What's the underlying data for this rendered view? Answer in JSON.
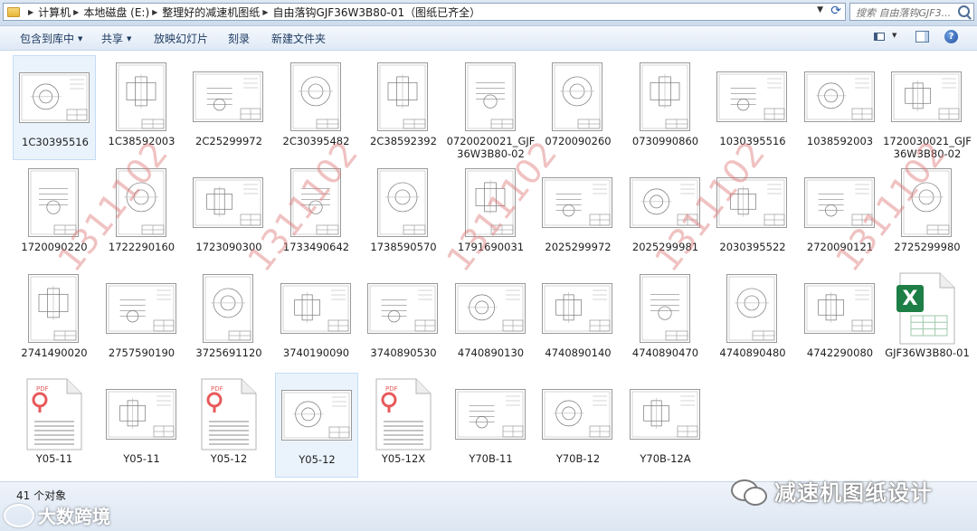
{
  "address": {
    "crumbs": [
      "计算机",
      "本地磁盘 (E:)",
      "整理好的减速机图纸",
      "自由落钩GJF36W3B80-01（图纸已齐全）"
    ]
  },
  "search": {
    "placeholder": "搜索 自由落钩GJF3..."
  },
  "toolbar": {
    "include_in_library": "包含到库中",
    "share": "共享",
    "slideshow": "放映幻灯片",
    "burn": "刻录",
    "new_folder": "新建文件夹"
  },
  "files": [
    {
      "name": "1C30395516",
      "type": "drawing",
      "variant": "land",
      "selected": true
    },
    {
      "name": "1C38592003",
      "type": "drawing",
      "variant": "port"
    },
    {
      "name": "2C25299972",
      "type": "drawing",
      "variant": "land"
    },
    {
      "name": "2C30395482",
      "type": "drawing",
      "variant": "port"
    },
    {
      "name": "2C38592392",
      "type": "drawing",
      "variant": "port"
    },
    {
      "name": "0720020021_GJF36W3B80-02",
      "type": "drawing",
      "variant": "port"
    },
    {
      "name": "0720090260",
      "type": "drawing",
      "variant": "port"
    },
    {
      "name": "0730990860",
      "type": "drawing",
      "variant": "port"
    },
    {
      "name": "1030395516",
      "type": "drawing",
      "variant": "land"
    },
    {
      "name": "1038592003",
      "type": "drawing",
      "variant": "land"
    },
    {
      "name": "1720030021_GJF36W3B80-02",
      "type": "drawing",
      "variant": "land"
    },
    {
      "name": "1720090220",
      "type": "drawing",
      "variant": "port"
    },
    {
      "name": "1722290160",
      "type": "drawing",
      "variant": "port"
    },
    {
      "name": "1723090300",
      "type": "drawing",
      "variant": "land"
    },
    {
      "name": "1733490642",
      "type": "drawing",
      "variant": "port"
    },
    {
      "name": "1738590570",
      "type": "drawing",
      "variant": "port"
    },
    {
      "name": "1791690031",
      "type": "drawing",
      "variant": "port"
    },
    {
      "name": "2025299972",
      "type": "drawing",
      "variant": "land"
    },
    {
      "name": "2025299981",
      "type": "drawing",
      "variant": "land"
    },
    {
      "name": "2030395522",
      "type": "drawing",
      "variant": "land"
    },
    {
      "name": "2720090121",
      "type": "drawing",
      "variant": "land"
    },
    {
      "name": "2725299980",
      "type": "drawing",
      "variant": "port"
    },
    {
      "name": "2741490020",
      "type": "drawing",
      "variant": "port"
    },
    {
      "name": "2757590190",
      "type": "drawing",
      "variant": "land"
    },
    {
      "name": "3725691120",
      "type": "drawing",
      "variant": "port"
    },
    {
      "name": "3740190090",
      "type": "drawing",
      "variant": "land"
    },
    {
      "name": "3740890530",
      "type": "drawing",
      "variant": "land"
    },
    {
      "name": "4740890130",
      "type": "drawing",
      "variant": "land"
    },
    {
      "name": "4740890140",
      "type": "drawing",
      "variant": "land"
    },
    {
      "name": "4740890470",
      "type": "drawing",
      "variant": "port"
    },
    {
      "name": "4740890480",
      "type": "drawing",
      "variant": "port"
    },
    {
      "name": "4742290080",
      "type": "drawing",
      "variant": "land"
    },
    {
      "name": "GJF36W3B80-01",
      "type": "excel"
    },
    {
      "name": "Y05-11",
      "type": "pdf"
    },
    {
      "name": "Y05-11",
      "type": "drawing",
      "variant": "land"
    },
    {
      "name": "Y05-12",
      "type": "pdf"
    },
    {
      "name": "Y05-12",
      "type": "drawing",
      "variant": "land",
      "selected": true
    },
    {
      "name": "Y05-12X",
      "type": "pdf"
    },
    {
      "name": "Y70B-11",
      "type": "drawing",
      "variant": "land"
    },
    {
      "name": "Y70B-12",
      "type": "drawing",
      "variant": "land"
    },
    {
      "name": "Y70B-12A",
      "type": "drawing",
      "variant": "land"
    }
  ],
  "pdf_badge": "PDF",
  "excel_badge": "X",
  "status": {
    "count": "41 个对象"
  },
  "watermark": [
    "1311102",
    "1311102",
    "1311102",
    "1311102",
    "1311102"
  ],
  "branding": {
    "left": "大数跨境",
    "right": "减速机图纸设计"
  },
  "colors": {
    "watermark": "#de7878",
    "excel_green": "#1d7f45",
    "pdf_red": "#e8595a"
  }
}
